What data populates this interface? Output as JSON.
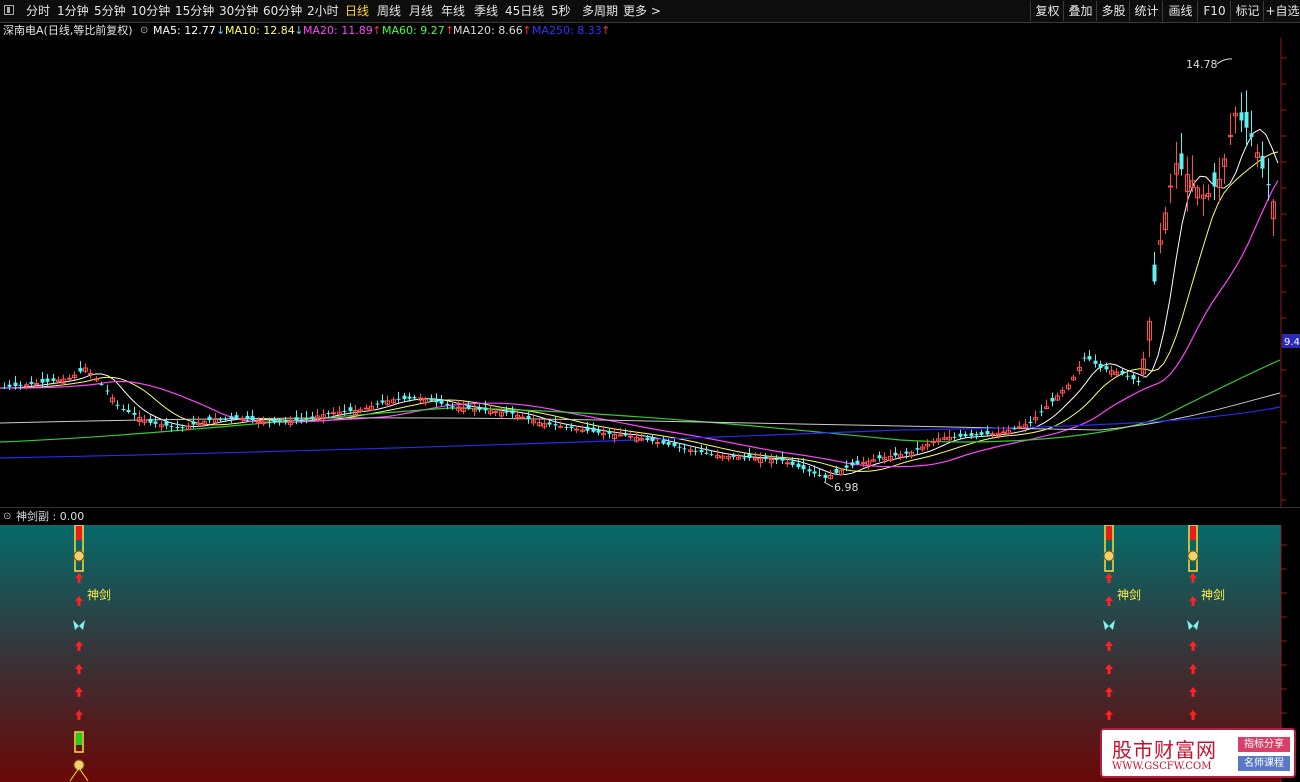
{
  "toolbar": {
    "periods": [
      "分时",
      "1分钟",
      "5分钟",
      "10分钟",
      "15分钟",
      "30分钟",
      "60分钟",
      "2小时",
      "日线",
      "周线",
      "月线",
      "年线",
      "季线",
      "45日线",
      "5秒",
      "多周期",
      "更多 >"
    ],
    "active_period": "日线",
    "right_buttons": [
      "复权",
      "叠加",
      "多股",
      "统计",
      "画线",
      "F10",
      "标记",
      "+自选"
    ]
  },
  "legend": {
    "title": "深南电A(日线,等比前复权)",
    "ma": [
      {
        "label": "MA5: 12.77",
        "arrow": "↓",
        "color": "#ffffff"
      },
      {
        "label": "MA10: 12.84",
        "arrow": "↓",
        "color": "#ffff66"
      },
      {
        "label": "MA20: 11.89",
        "arrow": "↑",
        "color": "#ff44ff"
      },
      {
        "label": "MA60: 9.27",
        "arrow": "↑",
        "color": "#44ff44"
      },
      {
        "label": "MA120: 8.66",
        "arrow": "↑",
        "color": "#dddddd"
      },
      {
        "label": "MA250: 8.33",
        "arrow": "↑",
        "color": "#3333ff"
      }
    ]
  },
  "price_panel": {
    "high_label": "14.78",
    "low_label": "6.98",
    "price_tag": "9.4"
  },
  "indicator_panel": {
    "title": "神剑副 : 0.00",
    "signal_text": "神剑",
    "signal_x": [
      79,
      1109,
      1193
    ]
  },
  "watermark": {
    "name": "股市财富网",
    "url": "WWW.GSCFW.COM",
    "tag1": "指标分享",
    "tag2": "名师课程"
  },
  "chart_data": {
    "type": "candlestick",
    "title": "深南电A(日线,等比前复权)",
    "high": 14.78,
    "low": 6.98,
    "ma": {
      "MA5": 12.77,
      "MA10": 12.84,
      "MA20": 11.89,
      "MA60": 9.27,
      "MA120": 8.66,
      "MA250": 8.33
    }
  }
}
